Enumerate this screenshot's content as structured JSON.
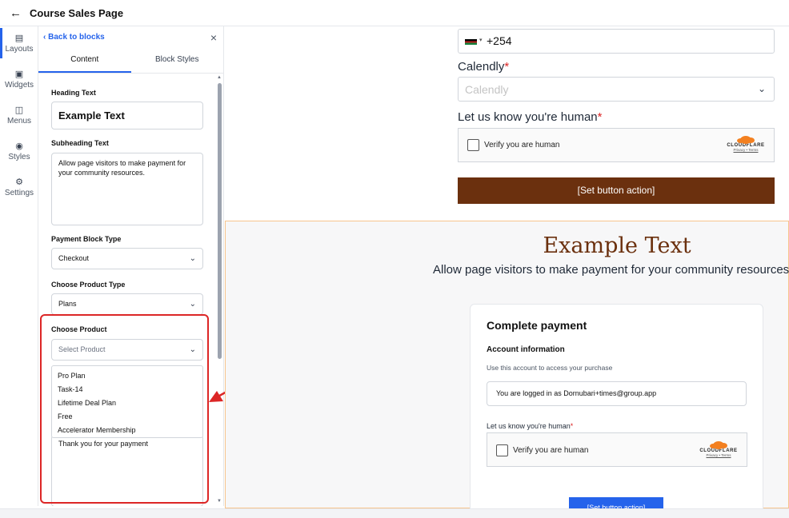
{
  "header": {
    "back_icon": "arrow-left-icon",
    "title": "Course Sales Page"
  },
  "rail": {
    "items": [
      {
        "label": "Layouts",
        "icon": "layouts-icon"
      },
      {
        "label": "Widgets",
        "icon": "widgets-icon"
      },
      {
        "label": "Menus",
        "icon": "menus-icon"
      },
      {
        "label": "Styles",
        "icon": "palette-icon"
      },
      {
        "label": "Settings",
        "icon": "gear-icon"
      }
    ]
  },
  "panel": {
    "back_label": "Back to blocks",
    "tabs": [
      "Content",
      "Block Styles"
    ],
    "heading_label": "Heading Text",
    "heading_value": "Example Text",
    "subheading_label": "Subheading Text",
    "subheading_value": "Allow page visitors to make payment for your community resources.",
    "payment_type_label": "Payment Block Type",
    "payment_type_value": "Checkout",
    "product_type_label": "Choose Product Type",
    "product_type_value": "Plans",
    "product_label": "Choose Product",
    "product_placeholder": "Select Product",
    "product_options": [
      "Pro Plan",
      "Task-14",
      "Lifetime Deal Plan",
      "Free",
      "Accelerator Membership"
    ],
    "thankyou_value": "Thank you for your payment"
  },
  "preview": {
    "phone_value": "+254",
    "calendly_label": "Calendly",
    "calendly_placeholder": "Calendly",
    "human_label": "Let us know you're human",
    "verify_text": "Verify you are human",
    "cloudflare_name": "CLOUDFLARE",
    "cloudflare_links": "Privacy • Terms",
    "set_button": "[Set button action]",
    "section_title": "Example Text",
    "section_subtitle": "Allow page visitors to make payment for your community resources.",
    "card": {
      "title": "Complete payment",
      "account_heading": "Account information",
      "account_note": "Use this account to access your purchase",
      "logged_in": "You are logged in as Dornubari+times@group.app",
      "human_label": "Let us know you're human",
      "verify_text": "Verify you are human",
      "button": "[Set button action]"
    }
  },
  "colors": {
    "accent": "#2563eb",
    "brown": "#6b300e",
    "highlight": "#dc2626",
    "cloudflare": "#f38020"
  }
}
